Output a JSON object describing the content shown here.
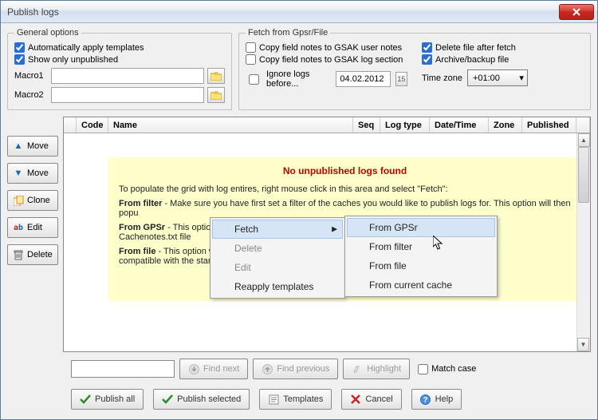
{
  "window": {
    "title": "Publish logs"
  },
  "general": {
    "legend": "General options",
    "auto_apply": "Automatically apply templates",
    "show_unpub": "Show only unpublished",
    "macro1_label": "Macro1",
    "macro2_label": "Macro2"
  },
  "fetch": {
    "legend": "Fetch from Gpsr/File",
    "copy_user": "Copy field notes to GSAK user notes",
    "copy_section": "Copy field notes to GSAK log section",
    "delete_after": "Delete file after fetch",
    "archive": "Archive/backup file",
    "ignore_label": "Ignore logs before...",
    "ignore_date": "04.02.2012",
    "tz_label": "Time zone",
    "tz_value": "+01:00"
  },
  "grid": {
    "cols": [
      "Code",
      "Name",
      "Seq",
      "Log type",
      "Date/Time",
      "Zone",
      "Published"
    ]
  },
  "notice": {
    "title": "No unpublished logs found",
    "intro": "To populate the grid with log entires, right mouse click in this area and select \"Fetch\":",
    "filter_b": "From filter",
    "filter_t": " - Make sure you have first set a filter of the caches you would like to publish logs for. This option will then popu",
    "gpsr_b": "From GPSr",
    "gpsr_t": " - This option\nCachenotes.txt file",
    "file_b": "From file",
    "file_t": " - This option w\ncompatible with the stan"
  },
  "side": {
    "move_up": "Move",
    "move_down": "Move",
    "clone": "Clone",
    "edit": "Edit",
    "delete": "Delete"
  },
  "context": {
    "fetch": "Fetch",
    "delete": "Delete",
    "edit": "Edit",
    "reapply": "Reapply templates",
    "sub_gpsr": "From GPSr",
    "sub_filter": "From filter",
    "sub_file": "From file",
    "sub_current": "From current cache"
  },
  "search": {
    "find_next": "Find next",
    "find_prev": "Find previous",
    "highlight": "Highlight",
    "match_case": "Match case"
  },
  "footer": {
    "publish_all": "Publish all",
    "publish_sel": "Publish selected",
    "templates": "Templates",
    "cancel": "Cancel",
    "help": "Help"
  }
}
